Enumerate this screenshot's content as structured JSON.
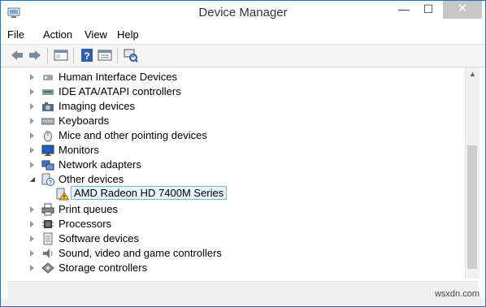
{
  "window": {
    "title": "Device Manager",
    "controls": {
      "minimize": "—",
      "maximize": "☐",
      "close": "✕"
    }
  },
  "menu": {
    "items": [
      {
        "label": "File"
      },
      {
        "label": "Action"
      },
      {
        "label": "View"
      },
      {
        "label": "Help"
      }
    ]
  },
  "toolbar": {
    "buttons": [
      "back-icon",
      "forward-icon",
      "show-hide-console-tree-icon",
      "help-icon",
      "properties-icon",
      "scan-hardware-changes-icon"
    ]
  },
  "tree": {
    "items": [
      {
        "label": "Human Interface Devices",
        "icon": "hid-icon",
        "expanded": false
      },
      {
        "label": "IDE ATA/ATAPI controllers",
        "icon": "ide-icon",
        "expanded": false
      },
      {
        "label": "Imaging devices",
        "icon": "camera-icon",
        "expanded": false
      },
      {
        "label": "Keyboards",
        "icon": "keyboard-icon",
        "expanded": false
      },
      {
        "label": "Mice and other pointing devices",
        "icon": "mouse-icon",
        "expanded": false
      },
      {
        "label": "Monitors",
        "icon": "monitor-icon",
        "expanded": false
      },
      {
        "label": "Network adapters",
        "icon": "network-icon",
        "expanded": false
      },
      {
        "label": "Other devices",
        "icon": "unknown-device-icon",
        "expanded": true
      },
      {
        "label": "AMD Radeon HD 7400M Series",
        "icon": "warning-device-icon",
        "child": true,
        "selected": true
      },
      {
        "label": "Print queues",
        "icon": "printer-icon",
        "expanded": false
      },
      {
        "label": "Processors",
        "icon": "processor-icon",
        "expanded": false
      },
      {
        "label": "Software devices",
        "icon": "software-device-icon",
        "expanded": false
      },
      {
        "label": "Sound, video and game controllers",
        "icon": "speaker-icon",
        "expanded": false
      },
      {
        "label": "Storage controllers",
        "icon": "storage-icon",
        "expanded": false
      }
    ]
  },
  "watermark": "wsxdn.com",
  "colors": {
    "border": "#1e73be",
    "selection": "#7ab3ea",
    "warning": "#f2c230"
  }
}
